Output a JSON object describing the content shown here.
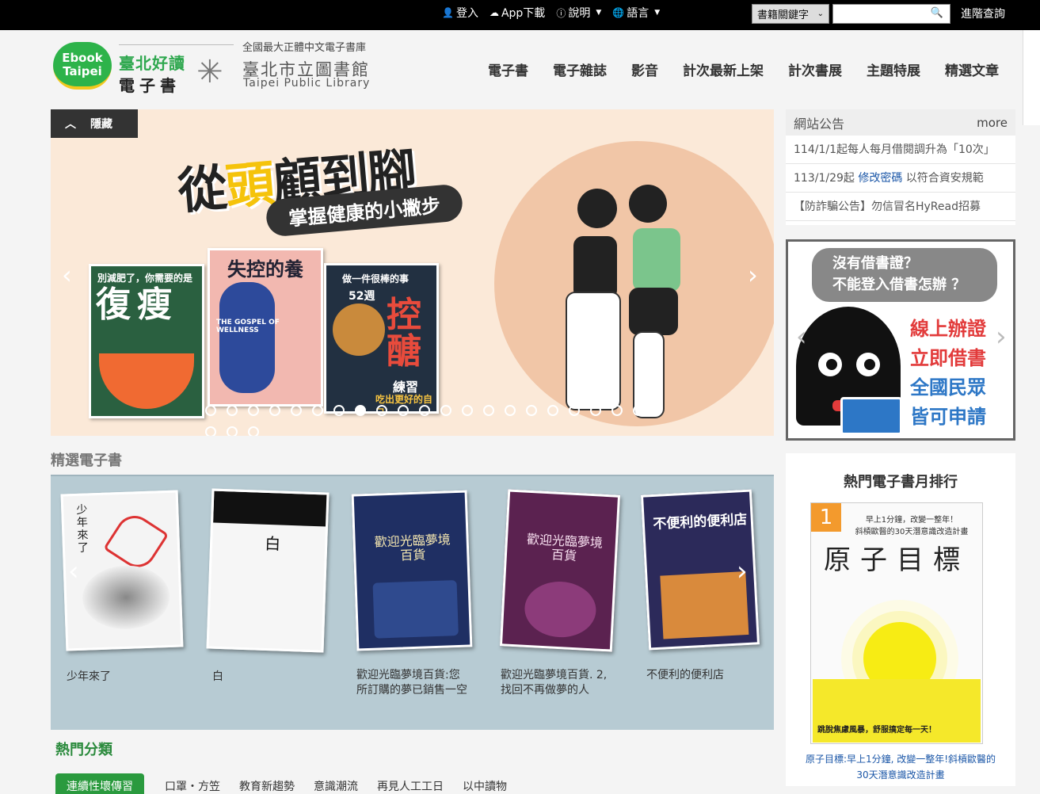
{
  "topbar": {
    "login": "登入",
    "app_download": "App下載",
    "help": "說明",
    "language": "語言",
    "search_type": "書籍關鍵字",
    "search_placeholder": "",
    "advanced_search": "進階查詢"
  },
  "logo": {
    "ebook_line1": "Ebook",
    "ebook_line2": "Taipei",
    "zh_line1": "臺北好讀",
    "zh_line2": "電子書",
    "tagline": "全國最大正體中文電子書庫",
    "library_zh": "臺北市立圖書館",
    "library_en": "Taipei Public Library"
  },
  "nav": [
    "電子書",
    "電子雜誌",
    "影音",
    "計次最新上架",
    "計次書展",
    "主題特展",
    "精選文章"
  ],
  "banner": {
    "hide_label": "隱藏",
    "title_a": "從",
    "title_b": "頭",
    "title_c": "顧到腳",
    "subtitle": "掌握健康的小撇步",
    "book1_sub": "別減肥了，你需要的是",
    "book1_title": "復瘦",
    "book2_title": "失控的養生",
    "book2_en": "THE GOSPEL OF WELLNESS",
    "book3_sub": "做一件很棒的事",
    "book3_weeks": "52週",
    "book3_title": "控醣",
    "book3_bottom": "練習",
    "book3_line": "吃出更好的自己",
    "dots_total": 24,
    "dot_active": 7
  },
  "notice": {
    "title": "網站公告",
    "more": "more",
    "items": [
      {
        "text": "114/1/1起每人每月借閱調升為「10次」",
        "link": ""
      },
      {
        "text_pre": "113/1/29起 ",
        "link": "修改密碼",
        "text_post": " 以符合資安規範"
      },
      {
        "text": "【防詐騙公告】勿信冒名HyRead招募",
        "link": ""
      }
    ]
  },
  "ad": {
    "bubble_line1": "沒有借書證？",
    "bubble_line2": "不能登入借書怎辦 ？",
    "slogan": [
      "線上辦證",
      "立即借書",
      "全國民眾",
      "皆可申請"
    ],
    "slogan_colors": [
      "#e23b3b",
      "#e23b3b",
      "#2d77c6",
      "#2d77c6"
    ]
  },
  "rank": {
    "title": "熱門電子書月排行",
    "number": "1",
    "cover_sub": "早上1分鐘，改變一整年！\n斜槓歐醫的30天潛意識改造計畫",
    "cover_title": "原子目標",
    "cover_bottom": "跳脫焦慮風暴，舒服搞定每一天！",
    "caption": "原子目標:早上1分鐘, 改變一整年!斜槓歐醫的30天潛意識改造計畫"
  },
  "featured": {
    "title": "精選電子書",
    "books": [
      {
        "title": "少年來了",
        "cover_text": "少年來了",
        "color": "#f4f4f4",
        "ink": "#222"
      },
      {
        "title": "白",
        "cover_text": "白",
        "color": "#f6f6f6",
        "ink": "#111"
      },
      {
        "title": "歡迎光臨夢境百貨:您所訂購的夢已銷售一空",
        "cover_text": "歡迎光臨夢境百貨",
        "color": "#1f2f63",
        "ink": "#f5e7b0"
      },
      {
        "title": "歡迎光臨夢境百貨. 2, 找回不再做夢的人",
        "cover_text": "歡迎光臨夢境百貨",
        "color": "#5b2250",
        "ink": "#f7dfef"
      },
      {
        "title": "不便利的便利店",
        "cover_text": "不便利的便利店",
        "color": "#2c2a5a",
        "ink": "#ffffff"
      }
    ]
  },
  "hot": {
    "title": "熱門分類",
    "categories": [
      "連續性壞傳習",
      "口罩・方笠",
      "教育新趨勢",
      "意識潮流",
      "再見人工工日",
      "以中讀物"
    ]
  }
}
